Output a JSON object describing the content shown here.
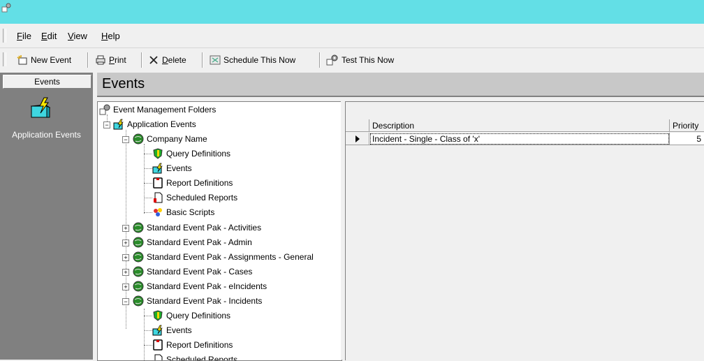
{
  "menu": {
    "items": [
      "File",
      "Edit",
      "View",
      "Help"
    ]
  },
  "toolbar": {
    "new_event": "New Event",
    "print": "Print",
    "delete": "Delete",
    "schedule_now": "Schedule This Now",
    "test_now": "Test This Now"
  },
  "left_panel": {
    "header": "Events",
    "app_events_label": "Application Events"
  },
  "main": {
    "title": "Events"
  },
  "tree": {
    "root": "Event Management Folders",
    "application_events": "Application Events",
    "company_name": "Company Name",
    "company_children": [
      "Query Definitions",
      "Events",
      "Report Definitions",
      "Scheduled Reports",
      "Basic Scripts"
    ],
    "paks": [
      "Standard Event Pak - Activities",
      "Standard Event Pak - Admin",
      "Standard Event Pak - Assignments - General",
      "Standard Event Pak - Cases",
      "Standard Event Pak - eIncidents",
      "Standard Event Pak - Incidents"
    ],
    "incident_children": [
      "Query Definitions",
      "Events",
      "Report Definitions",
      "Scheduled Reports"
    ]
  },
  "grid": {
    "columns": [
      "Description",
      "Priority"
    ],
    "rows": [
      {
        "description": "Incident - Single - Class of 'x'",
        "priority": "5"
      }
    ]
  }
}
